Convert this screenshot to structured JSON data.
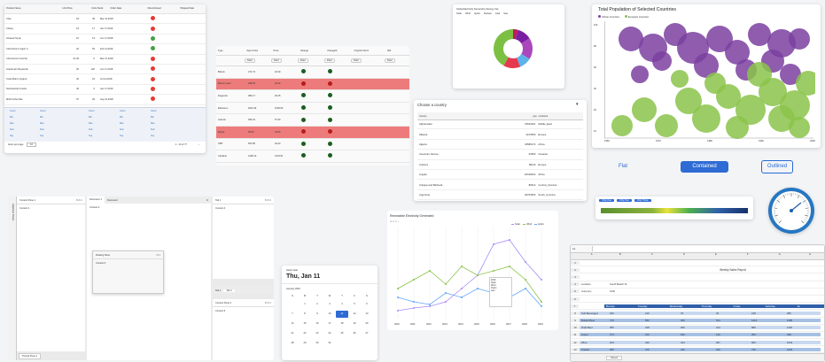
{
  "grid1": {
    "headers": [
      "Product Name",
      "",
      "",
      "Unit Price",
      "",
      "Units Stock",
      "Order Date",
      "",
      "Discontinued",
      "",
      "Shipped Date"
    ],
    "rows": [
      {
        "name": "Chai",
        "price": "18",
        "stock": "39",
        "date": "Mar 14,2018",
        "status": "red",
        "ship": ""
      },
      {
        "name": "Chang",
        "price": "19",
        "stock": "17",
        "date": "Jan 17,2019",
        "status": "red",
        "ship": ""
      },
      {
        "name": "Aniseed Syrup",
        "price": "10",
        "stock": "13",
        "date": "Jun 17,2018",
        "status": "green",
        "ship": ""
      },
      {
        "name": "Chef Anton's Cajun S",
        "price": "22",
        "stock": "53",
        "date": "Feb 11,2019",
        "status": "green",
        "ship": ""
      },
      {
        "name": "Chef Anton's Gumbo",
        "price": "21.35",
        "stock": "0",
        "date": "Mar 27,2018",
        "status": "red",
        "ship": ""
      },
      {
        "name": "Grandma's Boysenbe",
        "price": "25",
        "stock": "120",
        "date": "Jun 17,2018",
        "status": "red",
        "ship": ""
      },
      {
        "name": "Uncle Bob's Organic",
        "price": "30",
        "stock": "15",
        "date": "Jul 14,2018",
        "status": "red",
        "ship": ""
      },
      {
        "name": "Northwoods Cranbe",
        "price": "40",
        "stock": "6",
        "date": "Jan 17,2019",
        "status": "red",
        "ship": ""
      },
      {
        "name": "Mishi Kobe Niku",
        "price": "97",
        "stock": "29",
        "date": "Aug 11,2018",
        "status": "red",
        "ship": ""
      },
      {
        "name": "Ikura",
        "price": "31",
        "stock": "31",
        "date": "Mar 19,2019",
        "status": "green",
        "ship": ""
      }
    ],
    "summary_labels": [
      "Count",
      "Min",
      "Max",
      "Sum",
      "Avg"
    ],
    "pager": "Items per page",
    "page_size": "10",
    "page_info": "1 - 10 of 77"
  },
  "grid2": {
    "headers": [
      "Type",
      "Open Price",
      "Price",
      "Change",
      "Change%",
      "Chg/Vol Vol.IV",
      "Bid"
    ],
    "filter_label": "Filter",
    "rows": [
      {
        "name": "Bitcoin",
        "open": "271.73",
        "price": "22.30",
        "hl": false
      },
      {
        "name": "Bitcoin Cash",
        "open": "188.05",
        "price": "30.32",
        "hl": true
      },
      {
        "name": "Dogecoin",
        "open": "384.17",
        "price": "29.15",
        "hl": false
      },
      {
        "name": "Ethereum",
        "open": "2012.34",
        "price": "1039.60",
        "hl": false
      },
      {
        "name": "Litecoin",
        "open": "354.19",
        "price": "67.30",
        "hl": false
      },
      {
        "name": "Ripple",
        "open": "56.06",
        "price": "33.50",
        "hl": true
      },
      {
        "name": "XRP",
        "open": "501.85",
        "price": "94.43",
        "hl": false
      },
      {
        "name": "Cardano",
        "open": "4105.12",
        "price": "4176.61",
        "hl": false
      },
      {
        "name": "Neo Dogs",
        "open": "201.57",
        "price": "48.37",
        "hl": false
      }
    ]
  },
  "donut": {
    "title": "Global Electricity Demand by Energy Use",
    "legend": [
      "Solar",
      "Wind",
      "Hydro",
      "Nuclear",
      "Coal",
      "Gas"
    ]
  },
  "bubble": {
    "title": "Total Population of Selected Countries",
    "legend": [
      "African Countries",
      "European Countries"
    ],
    "xticks": [
      "1960",
      "1970",
      "1980",
      "1990",
      "2000"
    ],
    "yticks": [
      "100",
      "80",
      "60",
      "40",
      "20",
      "10"
    ],
    "ylabel": "Population (millions)",
    "buttons": {
      "flat": "Flat",
      "contained": "Contained",
      "outlined": "Outlined"
    }
  },
  "country": {
    "title": "Choose a country",
    "headers": [
      "country",
      "pop",
      "continent"
    ],
    "rows": [
      {
        "c": "Afghanistan",
        "p": "31533461",
        "k": "Middle_East"
      },
      {
        "c": "Albania",
        "p": "3213560",
        "k": "Europe"
      },
      {
        "c": "Algeria",
        "p": "34586174",
        "k": "Africa"
      },
      {
        "c": "American Samoa",
        "p": "54053",
        "k": "Oceania"
      },
      {
        "c": "Andorra",
        "p": "86116",
        "k": "Europe"
      },
      {
        "c": "Angola",
        "p": "18418402",
        "k": "Africa"
      },
      {
        "c": "Antigua and Barbuda",
        "p": "89612",
        "k": "Central_America"
      },
      {
        "c": "Argentina",
        "p": "40764563",
        "k": "South_America"
      }
    ]
  },
  "dock": {
    "pane1_title": "Content Pane 1",
    "pane1_content": "Content 1",
    "doc_tab1": "Document 1",
    "doc_tab2": "Document",
    "doc_content": "Content 2",
    "floating_title": "Floating Pane",
    "floating_content": "Content 3",
    "tab1": "Tab 1",
    "tab1_content": "Content 4",
    "tab1b": "Tab 1",
    "tab2b": "Tab 2",
    "pane2_title": "Content Pane 2",
    "pane2_content": "Content 6",
    "side_label": "Unpinned Panes",
    "bottom_tab": "Pinned Pane 2"
  },
  "calendar": {
    "label": "Select date",
    "date": "Thu, Jan 11",
    "month": "January 2024",
    "weekdays": [
      "S",
      "M",
      "T",
      "W",
      "T",
      "F",
      "S"
    ],
    "days": [
      "",
      "1",
      "2",
      "3",
      "4",
      "5",
      "6",
      "7",
      "8",
      "9",
      "10",
      "11",
      "12",
      "13",
      "14",
      "15",
      "16",
      "17",
      "18",
      "19",
      "20",
      "21",
      "22",
      "23",
      "24",
      "25",
      "26",
      "27",
      "28",
      "29",
      "30",
      "31",
      "",
      "",
      ""
    ],
    "selected": "11"
  },
  "line_chart": {
    "title": "Renewable Electricity Generated",
    "legend": [
      "Solar",
      "Wind",
      "Hydro"
    ],
    "xticks": [
      "2010",
      "2011",
      "2012",
      "2013",
      "2014",
      "2015",
      "2016",
      "2017",
      "2018",
      "2019"
    ],
    "tooltip": [
      "2016",
      "Solar",
      "Wind",
      "Hydro",
      "Geo"
    ]
  },
  "gauge": {
    "ticks": [
      "0",
      "10",
      "20",
      "30",
      "40",
      "50",
      "60",
      "70",
      "80",
      "90",
      "100"
    ],
    "chips": [
      "Chip One",
      "Chip Two",
      "Chip Three"
    ]
  },
  "spreadsheet": {
    "cell_ref": "A1",
    "cols": [
      "A",
      "B",
      "C",
      "D",
      "E",
      "F",
      "G",
      "H"
    ],
    "title": "Weekly Sales Report",
    "location_label": "Location",
    "location_value": "South Beach St",
    "currency_label": "Currency",
    "currency_value": "USD",
    "header_row": [
      "",
      "Monday",
      "Tuesday",
      "Wednesday",
      "Thursday",
      "Friday",
      "Saturday",
      "Su"
    ],
    "rows": [
      [
        "Soft Beverages",
        "183",
        "216",
        "79",
        "33",
        "218",
        "285"
      ],
      [
        "Bottled Beer",
        "715",
        "553",
        "456",
        "514",
        "1214",
        "1485"
      ],
      [
        "Draft Beer",
        "355",
        "318",
        "290",
        "414",
        "689",
        "1118"
      ],
      [
        "Liquor",
        "374",
        "216",
        "150",
        "140",
        "253",
        "348"
      ],
      [
        "Wine",
        "109",
        "449",
        "414",
        "457",
        "660",
        "1019"
      ],
      [
        "Snacks",
        "668",
        "476",
        "420",
        "320",
        "736",
        "1203"
      ],
      [
        "Potato Chips",
        "306",
        "210",
        "343",
        "367",
        "817",
        "673"
      ]
    ],
    "sheet_tab": "Sheet1"
  }
}
